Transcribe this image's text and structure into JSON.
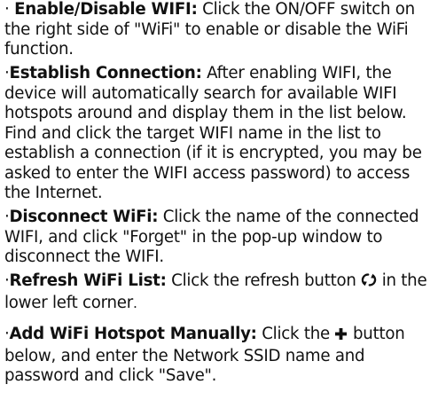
{
  "items": [
    {
      "bullet": "· ",
      "heading": "Enable/Disable WIFI:",
      "text": " Click the ON/OFF switch on the right side of \"WiFi\" to enable or disable the WiFi function."
    },
    {
      "bullet": "·",
      "heading": "Establish Connection:",
      "text": " After enabling WIFI, the device will automatically search for available WIFI hotspots around and display them in the list below. Find and click the target WIFI name in the list to establish a connection (if it is encrypted, you may be asked to enter the WIFI access password) to access the Internet."
    },
    {
      "bullet": "·",
      "heading": "Disconnect WiFi:",
      "text": " Click the name of the connected WIFI, and click \"Forget\" in the pop-up window to disconnect the WIFI."
    },
    {
      "bullet": "·",
      "heading": "Refresh WiFi List:",
      "text_before": " Click the refresh button ",
      "icon": "refresh-icon",
      "text_after": " in the lower left corner",
      "tail": "."
    },
    {
      "bullet": "·",
      "heading": "Add WiFi Hotspot Manually:",
      "text_before": " Click the ",
      "icon": "plus-icon",
      "text_after": " button below, and enter the Network SSID name and password and click \"Save\"."
    }
  ]
}
